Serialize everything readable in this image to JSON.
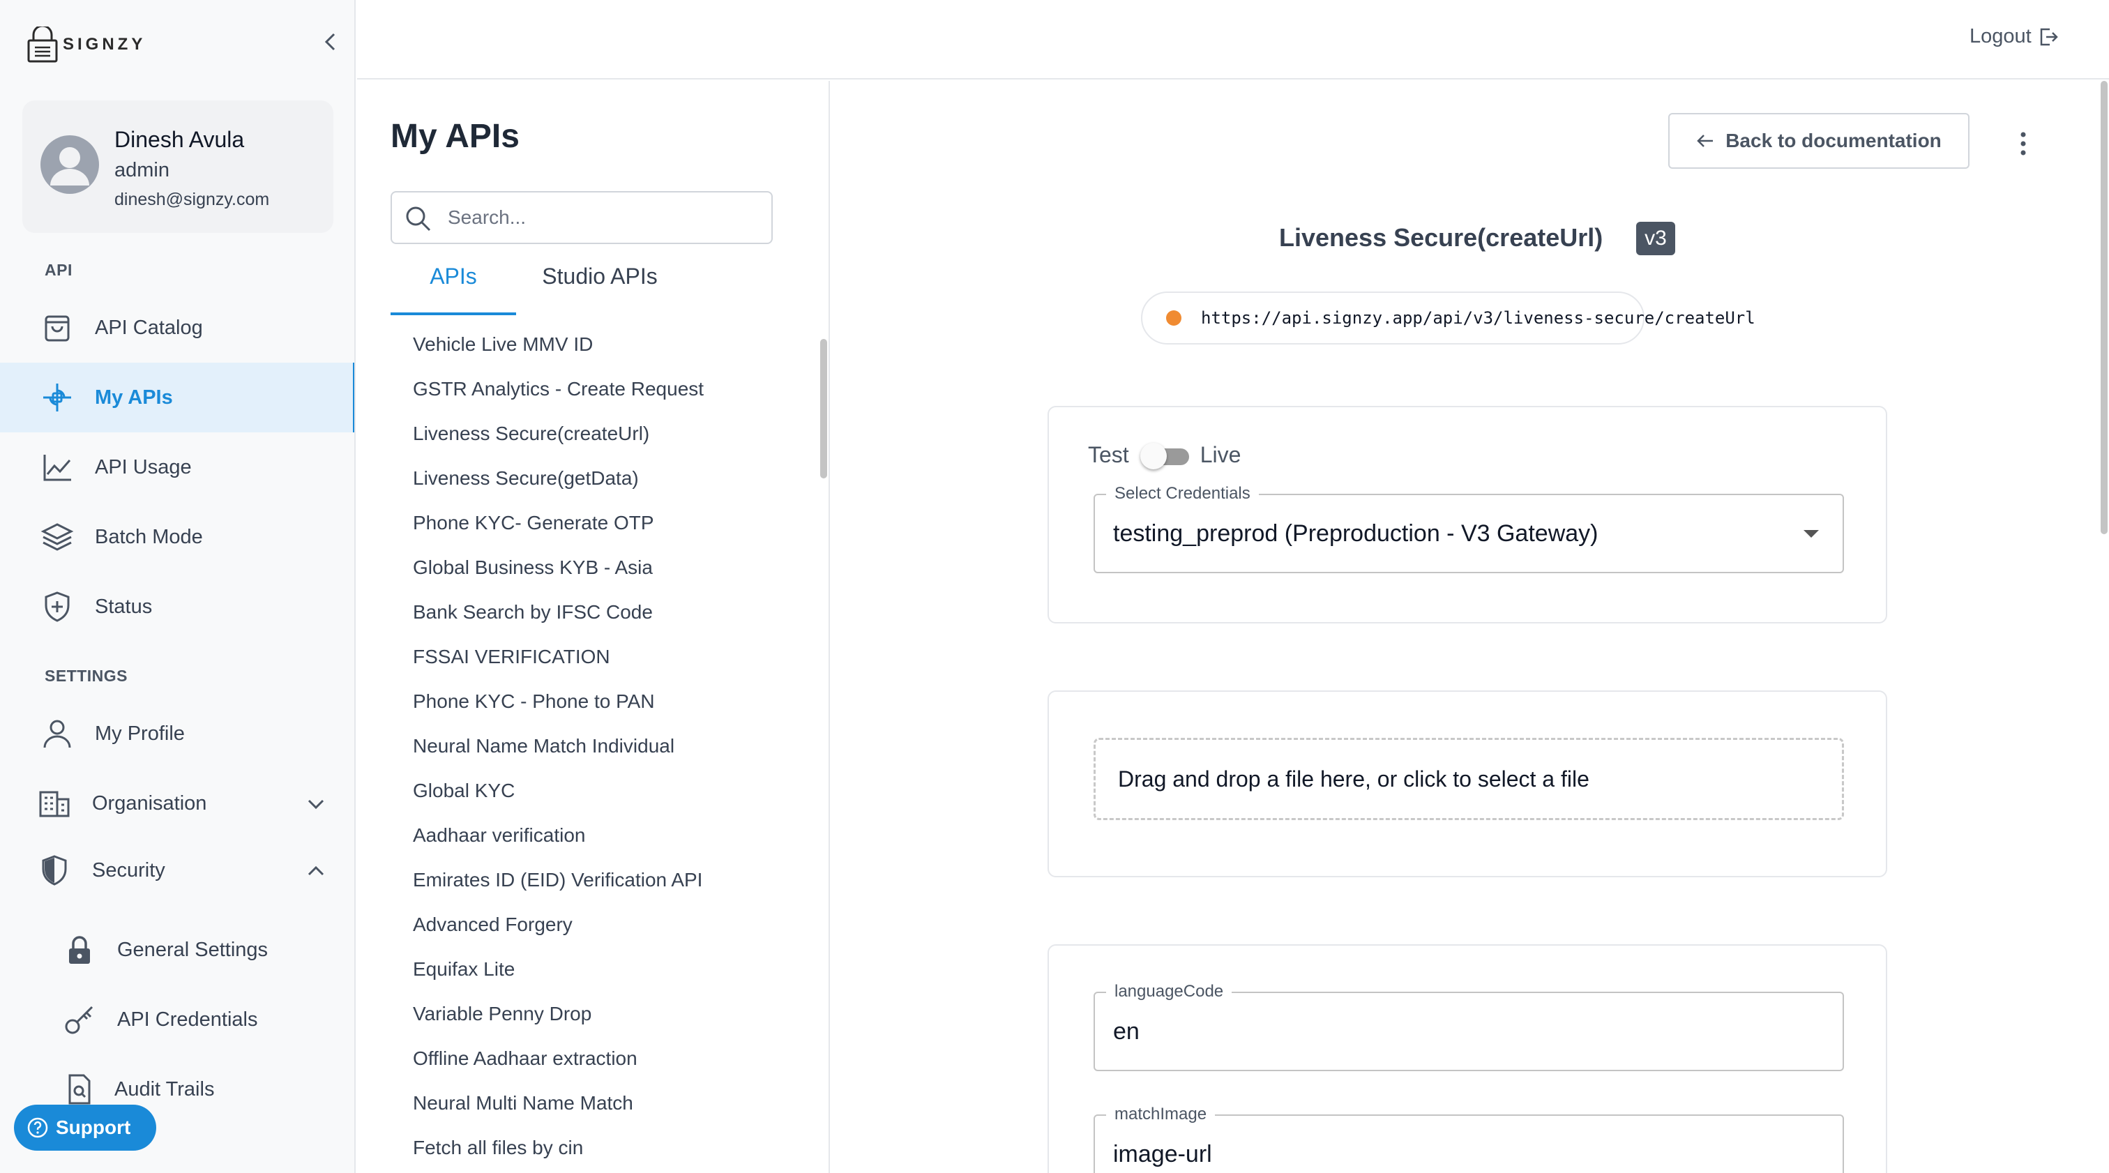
{
  "brand": {
    "name": "SIGNZY"
  },
  "user": {
    "name": "Dinesh Avula",
    "role": "admin",
    "email": "dinesh@signzy.com"
  },
  "sidebar": {
    "section_api": "API",
    "section_settings": "SETTINGS",
    "items": [
      {
        "label": "API Catalog",
        "icon": "shopping-bag-icon"
      },
      {
        "label": "My APIs",
        "icon": "api-link-icon",
        "active": true
      },
      {
        "label": "API Usage",
        "icon": "line-chart-icon"
      },
      {
        "label": "Batch Mode",
        "icon": "layers-icon"
      },
      {
        "label": "Status",
        "icon": "shield-plus-icon"
      }
    ],
    "settings_items": [
      {
        "label": "My Profile",
        "icon": "person-icon"
      },
      {
        "label": "Organisation",
        "icon": "building-icon"
      },
      {
        "label": "Security",
        "icon": "shield-icon"
      }
    ],
    "security_sub": [
      {
        "label": "General Settings",
        "icon": "lock-icon"
      },
      {
        "label": "API Credentials",
        "icon": "key-icon"
      },
      {
        "label": "Audit Trails",
        "icon": "search-document-icon"
      }
    ],
    "support_label": "Support"
  },
  "topbar": {
    "logout_label": "Logout"
  },
  "apilist": {
    "title": "My APIs",
    "search_placeholder": "Search...",
    "tabs": [
      "APIs",
      "Studio APIs"
    ],
    "items": [
      "Vehicle Live MMV ID",
      "GSTR Analytics - Create Request",
      "Liveness Secure(createUrl)",
      "Liveness Secure(getData)",
      "Phone KYC- Generate OTP",
      "Global Business KYB - Asia",
      "Bank Search by IFSC Code",
      "FSSAI VERIFICATION",
      "Phone KYC - Phone to PAN",
      "Neural Name Match Individual",
      "Global KYC",
      "Aadhaar verification",
      "Emirates ID (EID) Verification API",
      "Advanced Forgery",
      "Equifax Lite",
      "Variable Penny Drop",
      "Offline Aadhaar extraction",
      "Neural Multi Name Match",
      "Fetch all files by cin"
    ]
  },
  "detail": {
    "back_label": "Back to documentation",
    "api_title": "Liveness Secure(createUrl)",
    "version": "v3",
    "url": "https://api.signzy.app/api/v3/liveness-secure/createUrl",
    "status_color": "#f08b32",
    "env_test": "Test",
    "env_live": "Live",
    "credentials_label": "Select Credentials",
    "credentials_value": "testing_preprod (Preproduction - V3 Gateway)",
    "dropzone_text": "Drag and drop a file here, or click to select a file",
    "fields": [
      {
        "label": "languageCode",
        "value": "en"
      },
      {
        "label": "matchImage",
        "value": "image-url"
      }
    ]
  },
  "colors": {
    "accent": "#1a8ad8",
    "active_bg": "#e3f0fb"
  }
}
